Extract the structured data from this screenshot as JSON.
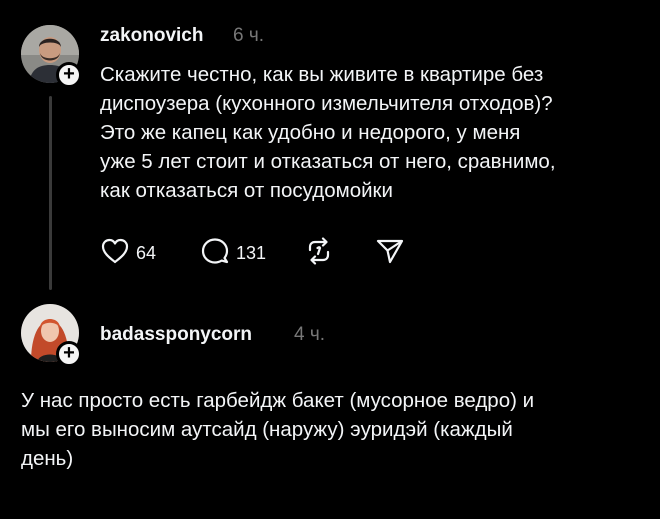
{
  "colors": {
    "background": "#000000",
    "text": "#f3f5f7",
    "muted": "#777777",
    "thread_line": "#3a3a3a"
  },
  "post": {
    "username": "zakonovich",
    "time": "6 ч.",
    "text_lines": [
      "Скажите честно, как вы живите в квартире без",
      "диспоузера (кухонного измельчителя отходов)?",
      "Это же капец как удобно и недорого, у меня",
      "уже 5 лет стоит и отказаться от него, сравнимо,",
      "как отказаться от посудомойки"
    ],
    "actions": {
      "like_icon": "heart-icon",
      "like_count": "64",
      "comment_icon": "comment-bubble-icon",
      "comment_count": "131",
      "repost_icon": "repost-icon",
      "share_icon": "send-icon"
    },
    "follow_badge": "+"
  },
  "reply": {
    "username": "badassponycorn",
    "time": "4 ч.",
    "text_lines": [
      "У нас просто есть гарбейдж бакет (мусорное ведро) и",
      "мы его выносим аутсайд (наружу) эуридэй (каждый",
      "день)"
    ],
    "follow_badge": "+"
  }
}
